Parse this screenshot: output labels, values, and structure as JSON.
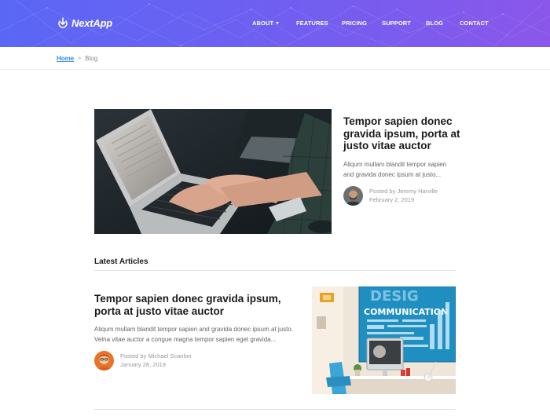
{
  "app": {
    "brand": "NextApp",
    "brand_icon": "download-cloud-icon",
    "accent_gradient": [
      "#5a67f5",
      "#8a57ea"
    ],
    "link_color": "#2e8be6"
  },
  "nav": {
    "items": [
      {
        "label": "ABOUT",
        "has_dropdown": true
      },
      {
        "label": "FEATURES"
      },
      {
        "label": "PRICING"
      },
      {
        "label": "SUPPORT"
      },
      {
        "label": "BLOG"
      },
      {
        "label": "CONTACT"
      }
    ]
  },
  "breadcrumb": {
    "home": "Home",
    "separator": "»",
    "current": "Blog"
  },
  "featured": {
    "title": "Tempor sapien donec gravida ipsum, porta at justo vitae auctor",
    "excerpt": "Aliqum mullam blandit tempor sapien and gravida donec ipsum at justo...",
    "author": "Posted by Jeremy Harville",
    "date": "February 2, 2019",
    "image": "laptop-typing-photo"
  },
  "latest": {
    "heading": "Latest Articles",
    "articles": [
      {
        "title": "Tempor sapien donec gravida ipsum, porta at justo vitae auctor",
        "excerpt": "Aliqum mullam blandit tempor sapien and gravida donec ipsum at justo. Velna vitae auctor a congue magna tempor sapien eget gravida...",
        "author": "Posted by Michael Scanlon",
        "date": "January 28, 2019",
        "image": "design-communication-desk-photo",
        "image_text": "COMMUNICATION"
      }
    ]
  }
}
